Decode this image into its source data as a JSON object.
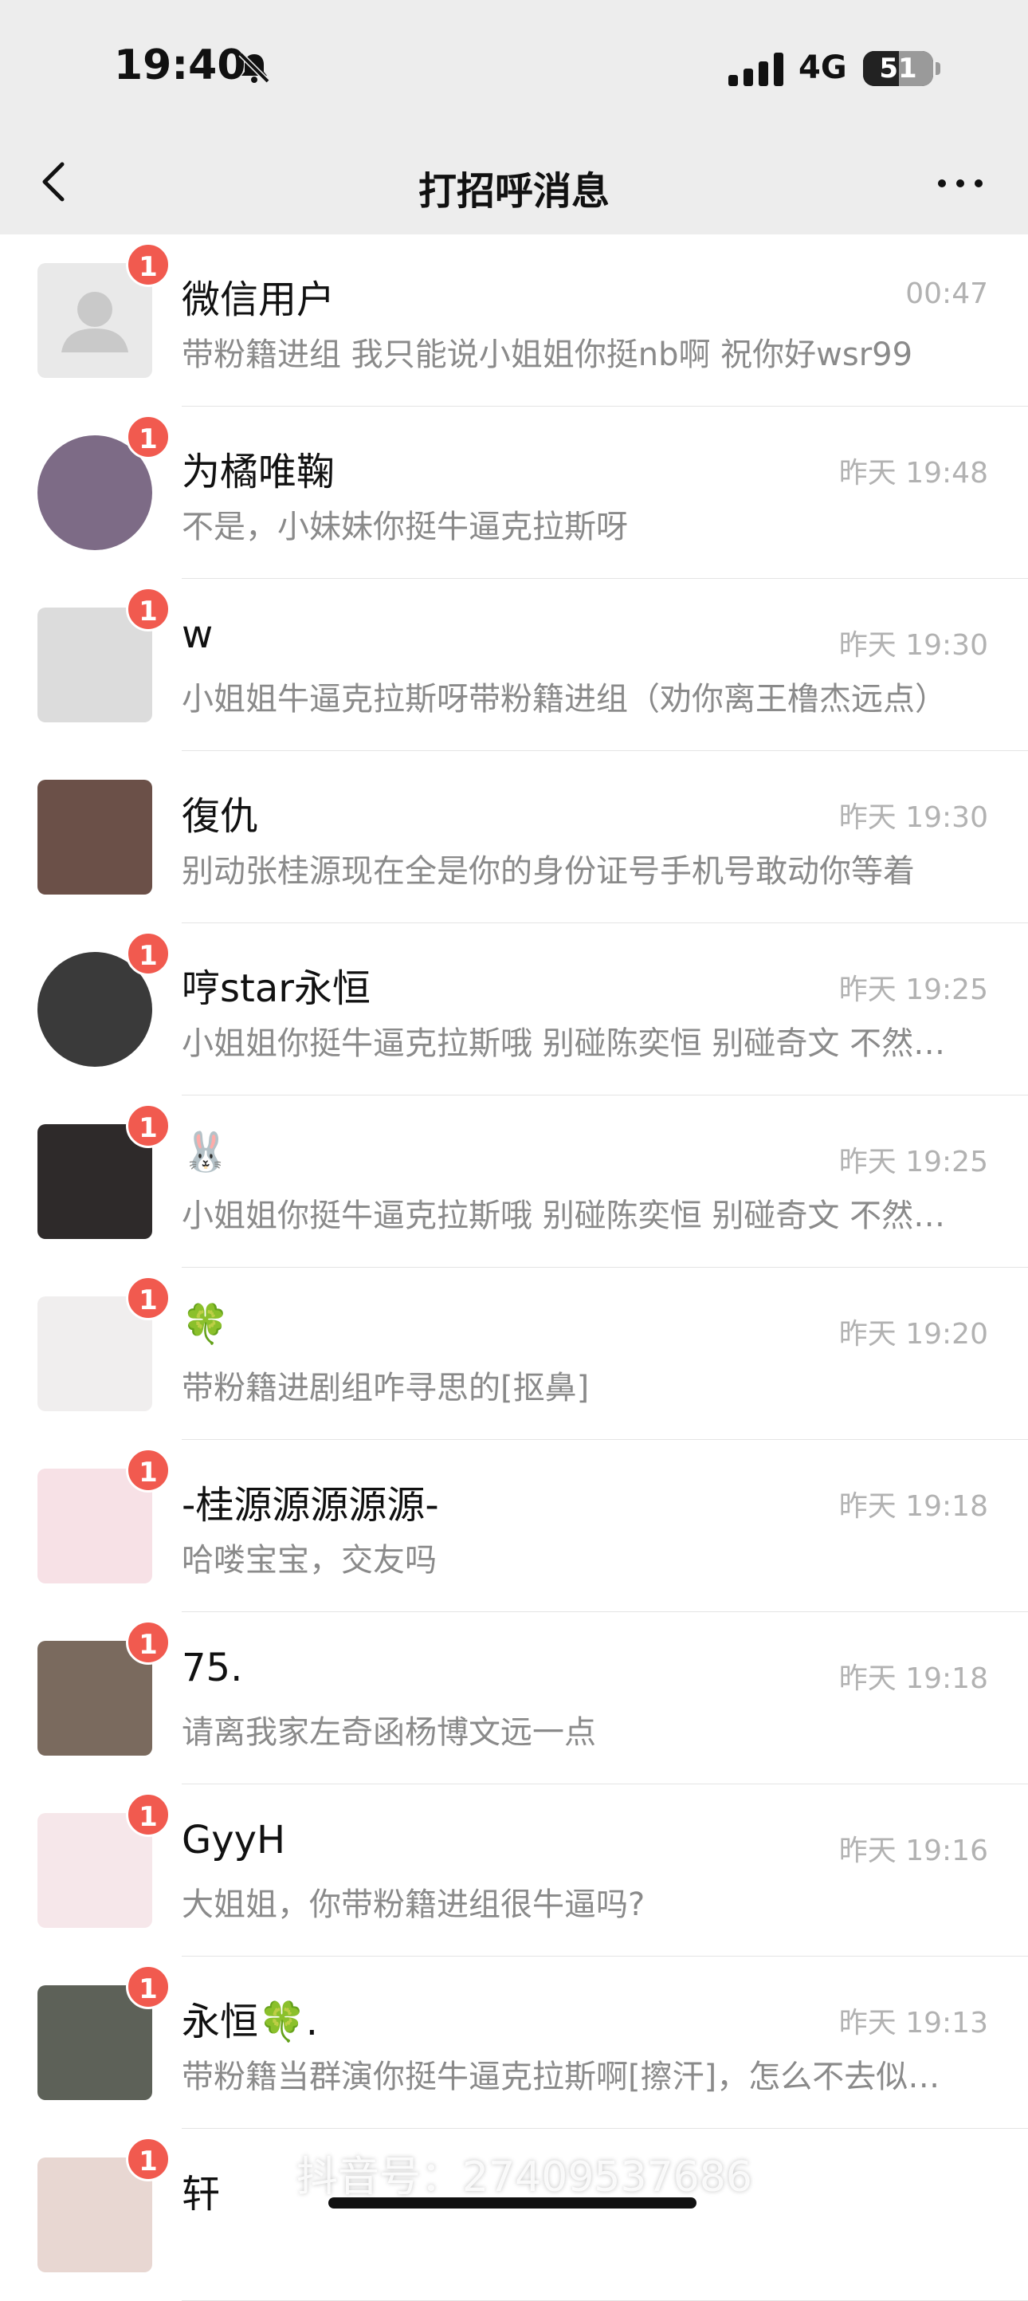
{
  "status_bar": {
    "time": "19:40",
    "network": "4G",
    "battery": "51",
    "battery_level": 0.51
  },
  "nav": {
    "title": "打招呼消息"
  },
  "items": [
    {
      "name": "微信用户",
      "message": "带粉籍进组 我只能说小姐姐你挺nb啊 祝你好wsr99",
      "time": "00:47",
      "badge": "1",
      "avatar_color": "#e9e9e9"
    },
    {
      "name": "为橘唯鞠",
      "message": "不是，小妹妹你挺牛逼克拉斯呀",
      "time": "昨天 19:48",
      "badge": "1",
      "avatar_color": "#7d6b86"
    },
    {
      "name": "w",
      "message": "小姐姐牛逼克拉斯呀带粉籍进组（劝你离王橹杰远点）",
      "time": "昨天 19:30",
      "badge": "1",
      "avatar_color": "#dcdcdc"
    },
    {
      "name": "復仇",
      "message": "别动张桂源现在全是你的身份证号手机号敢动你等着",
      "time": "昨天 19:30",
      "badge": "",
      "avatar_color": "#6b5048"
    },
    {
      "name": "哼star永恒",
      "message": "小姐姐你挺牛逼克拉斯哦 别碰陈奕恒 别碰奇文 不然…",
      "time": "昨天 19:25",
      "badge": "1",
      "avatar_color": "#3a3a3a"
    },
    {
      "name": "🐰",
      "message": "小姐姐你挺牛逼克拉斯哦 别碰陈奕恒 别碰奇文 不然…",
      "time": "昨天 19:25",
      "badge": "1",
      "avatar_color": "#2e2a2a"
    },
    {
      "name": "🍀",
      "message": "带粉籍进剧组咋寻思的[抠鼻]",
      "time": "昨天 19:20",
      "badge": "1",
      "avatar_color": "#f0eeee"
    },
    {
      "name": "-桂源源源源源-",
      "message": "哈喽宝宝，交友吗",
      "time": "昨天 19:18",
      "badge": "1",
      "avatar_color": "#f7e1e6"
    },
    {
      "name": "75.",
      "message": "请离我家左奇函杨博文远一点",
      "time": "昨天 19:18",
      "badge": "1",
      "avatar_color": "#7a6a5e"
    },
    {
      "name": "GyyH",
      "message": "大姐姐，你带粉籍进组很牛逼吗?",
      "time": "昨天 19:16",
      "badge": "1",
      "avatar_color": "#f6e7ea"
    },
    {
      "name": "永恒🍀.",
      "message": "带粉籍当群演你挺牛逼克拉斯啊[擦汗]，怎么不去似…",
      "time": "昨天 19:13",
      "badge": "1",
      "avatar_color": "#5d6158"
    },
    {
      "name": "轩",
      "message": "",
      "time": "",
      "badge": "1",
      "avatar_color": "#e8d7d2"
    }
  ],
  "watermark": "抖音号：27409537686"
}
